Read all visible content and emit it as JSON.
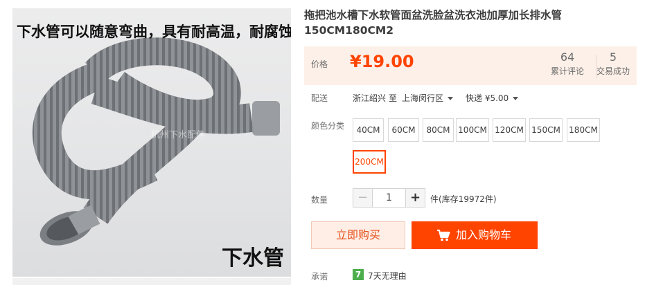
{
  "product": {
    "title": "拖把池水槽下水软管面盆洗脸盆洗衣池加厚加长排水管150CM180CM2",
    "image": {
      "caption_top": "下水管可以随意弯曲，具有耐高温，耐腐蚀，抗老化等优点",
      "caption_bottom": "下水管",
      "watermark": "杭州下水配件",
      "hose_color": "#8a8d91"
    }
  },
  "price": {
    "label": "价格",
    "value": "¥19.00",
    "color": "#ff4400"
  },
  "stats": {
    "reviews_count": "64",
    "reviews_label": "累计评论",
    "deals_count": "5",
    "deals_label": "交易成功"
  },
  "shipping": {
    "label": "配送",
    "from": "浙江绍兴",
    "to_prefix": "至",
    "to": "上海闵行区",
    "method": "快递 ¥5.00"
  },
  "sku": {
    "label": "颜色分类",
    "options": [
      "40CM",
      "60CM",
      "80CM",
      "100CM",
      "120CM",
      "150CM",
      "180CM",
      "200CM"
    ],
    "selected": "200CM"
  },
  "quantity": {
    "label": "数量",
    "minus": "−",
    "value": "1",
    "plus": "+",
    "stock": "件(库存19972件)"
  },
  "actions": {
    "buy_now": "立即购买",
    "add_to_cart": "加入购物车",
    "cart_icon": "cart-icon",
    "accent": "#ff4400"
  },
  "promise": {
    "label": "承诺",
    "badge": "7",
    "text": "7天无理由",
    "badge_color": "#4cae4c"
  }
}
